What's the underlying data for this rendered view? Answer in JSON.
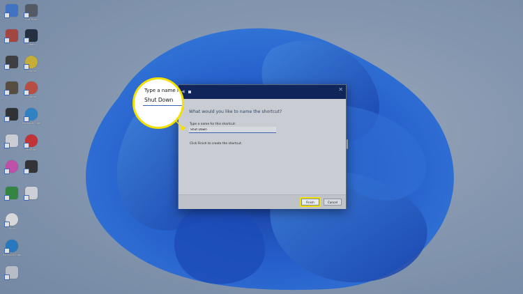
{
  "desktop": {
    "icons": [
      {
        "label": "",
        "color": "#3e7bd6"
      },
      {
        "label": "Shut Down",
        "color": "#545b66"
      },
      {
        "label": "",
        "color": "#b5423a"
      },
      {
        "label": "Steam",
        "color": "#1b2838"
      },
      {
        "label": "",
        "color": "#3a3a3a"
      },
      {
        "label": "Chrome",
        "color": "#e0c030"
      },
      {
        "label": "",
        "color": "#5a4a3a"
      },
      {
        "label": "Chrome",
        "color": "#d04b3b"
      },
      {
        "label": "",
        "color": "#2a2a2a"
      },
      {
        "label": "Microsoft Edge",
        "color": "#2b8bd6"
      },
      {
        "label": "",
        "color": "#e4e6ea"
      },
      {
        "label": "YouTube",
        "color": "#d92b2b"
      },
      {
        "label": "",
        "color": "#d64fb7"
      },
      {
        "label": "",
        "color": "#2c2c2c"
      },
      {
        "label": "",
        "color": "#2f8f3a"
      },
      {
        "label": "",
        "color": "#e8eaee"
      },
      {
        "label": "iTunes",
        "color": "#f3f3f3"
      },
      {
        "label": "Microsoft Edge",
        "color": "#1f7fcf"
      },
      {
        "label": "",
        "color": "#cdd3db"
      }
    ]
  },
  "dialog": {
    "back_icon": "back-arrow-icon",
    "close_symbol": "✕",
    "heading": "What would you like to name the shortcut?",
    "field_label": "Type a name for this shortcut:",
    "field_value": "Shut Down",
    "instruction": "Click Finish to create the shortcut.",
    "finish_label": "Finish",
    "cancel_label": "Cancel"
  },
  "callout": {
    "label": "Type a name f",
    "value": "Shut Down",
    "highlight_color": "#f2e000"
  }
}
